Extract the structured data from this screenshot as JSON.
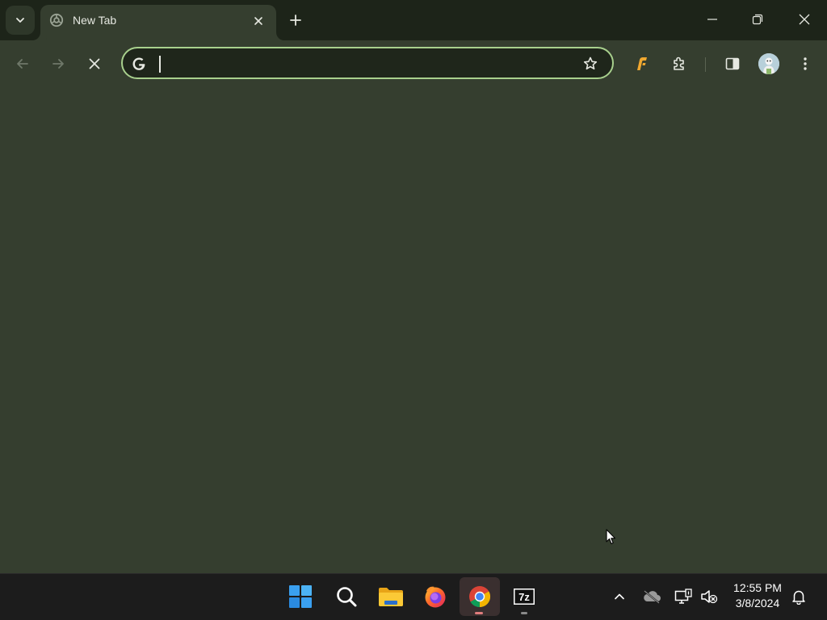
{
  "window": {
    "tab": {
      "title": "New Tab",
      "favicon": "chrome-newtab-icon"
    },
    "controls": [
      "minimize",
      "restore",
      "close"
    ]
  },
  "toolbar": {
    "omnibox": {
      "value": "",
      "placeholder": ""
    },
    "buttons": [
      "back",
      "forward",
      "stop",
      "bookmark-star",
      "extension-pin",
      "extensions",
      "side-panel",
      "profile",
      "menu"
    ]
  },
  "taskbar": {
    "apps": [
      {
        "name": "Start",
        "icon": "windows-icon"
      },
      {
        "name": "Search",
        "icon": "search-icon"
      },
      {
        "name": "File Explorer",
        "icon": "folder-icon"
      },
      {
        "name": "Firefox",
        "icon": "firefox-icon"
      },
      {
        "name": "Google Chrome",
        "icon": "chrome-icon",
        "active": true
      },
      {
        "name": "7-Zip",
        "icon": "sevenzip-icon"
      }
    ],
    "tray": {
      "time": "12:55 PM",
      "date": "3/8/2024"
    }
  },
  "colors": {
    "page_bg": "#353e2f",
    "tabstrip_bg": "#1d2419",
    "omnibox_border": "#a8d08d",
    "taskbar_bg": "#1c1c1c"
  }
}
